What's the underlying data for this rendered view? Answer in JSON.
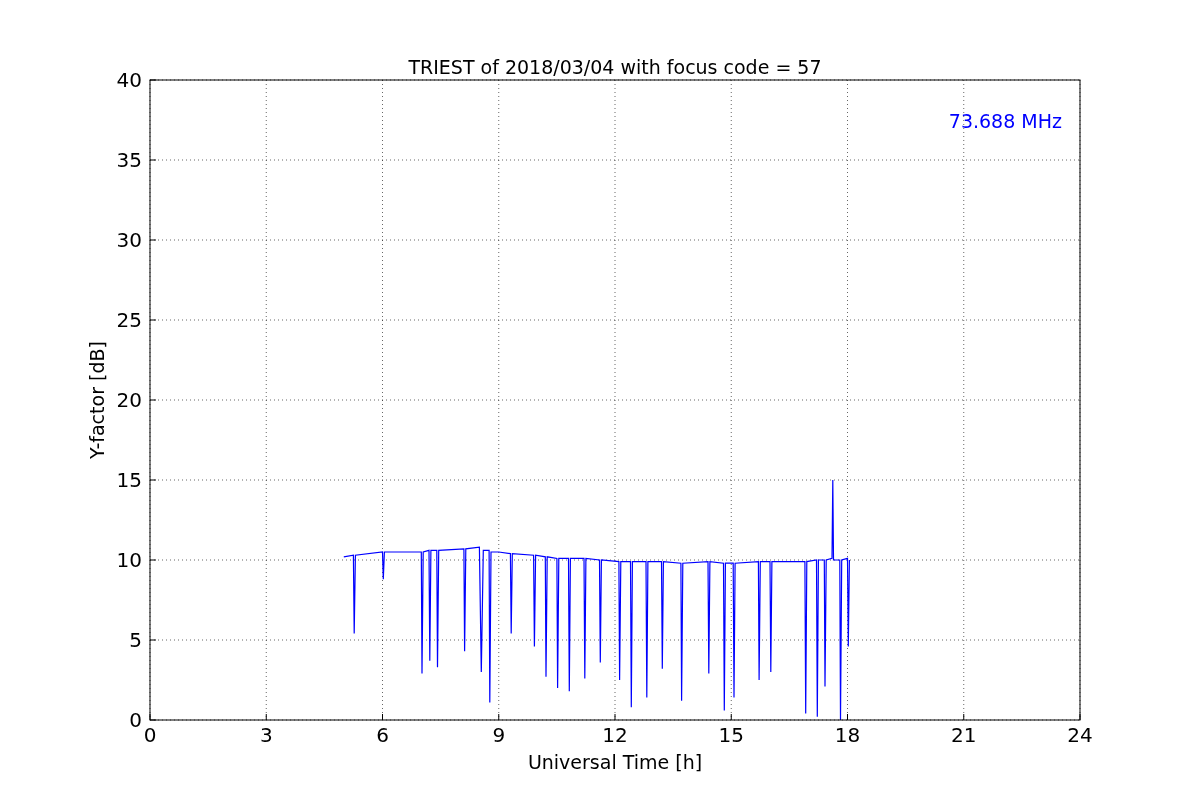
{
  "chart_data": {
    "type": "line",
    "title": "TRIEST of 2018/03/04 with focus code = 57",
    "xlabel": "Universal Time [h]",
    "ylabel": "Y-factor [dB]",
    "x": [
      5.0,
      5.25,
      5.27,
      5.3,
      6.0,
      6.02,
      6.05,
      7.0,
      7.02,
      7.05,
      7.2,
      7.22,
      7.25,
      7.4,
      7.42,
      7.45,
      8.1,
      8.12,
      8.15,
      8.5,
      8.55,
      8.6,
      8.75,
      8.77,
      8.8,
      9.0,
      9.3,
      9.32,
      9.35,
      9.9,
      9.92,
      9.95,
      10.2,
      10.22,
      10.25,
      10.5,
      10.52,
      10.55,
      10.8,
      10.82,
      10.85,
      11.2,
      11.22,
      11.25,
      11.6,
      11.62,
      11.65,
      12.1,
      12.12,
      12.15,
      12.4,
      12.42,
      12.45,
      12.8,
      12.82,
      12.85,
      13.2,
      13.22,
      13.25,
      13.7,
      13.72,
      13.75,
      14.4,
      14.42,
      14.45,
      14.8,
      14.82,
      14.85,
      15.05,
      15.07,
      15.1,
      15.7,
      15.72,
      15.75,
      16.0,
      16.02,
      16.05,
      16.9,
      16.92,
      16.95,
      17.2,
      17.22,
      17.25,
      17.4,
      17.42,
      17.45,
      17.6,
      17.62,
      17.64,
      17.8,
      17.82,
      17.85,
      18.0,
      18.02,
      18.05
    ],
    "series": [
      {
        "name": "73.688 MHz",
        "color": "#0000ff",
        "values": [
          10.2,
          10.3,
          5.4,
          10.3,
          10.5,
          8.8,
          10.5,
          10.5,
          2.9,
          10.5,
          10.6,
          3.7,
          10.6,
          10.6,
          3.3,
          10.6,
          10.7,
          4.3,
          10.7,
          10.8,
          3.0,
          10.6,
          10.6,
          1.1,
          10.5,
          10.5,
          10.4,
          5.4,
          10.4,
          10.3,
          4.6,
          10.3,
          10.2,
          2.7,
          10.2,
          10.1,
          2.0,
          10.1,
          10.1,
          1.8,
          10.1,
          10.1,
          2.6,
          10.1,
          10.0,
          3.6,
          10.0,
          9.9,
          2.5,
          9.9,
          9.9,
          0.8,
          9.9,
          9.9,
          1.4,
          9.9,
          9.9,
          3.2,
          9.9,
          9.8,
          1.2,
          9.8,
          9.9,
          2.9,
          9.9,
          9.8,
          0.6,
          9.8,
          9.8,
          1.4,
          9.8,
          9.9,
          2.5,
          9.9,
          9.9,
          3.0,
          9.9,
          9.9,
          0.4,
          9.9,
          10.0,
          0.2,
          10.0,
          10.0,
          2.1,
          10.0,
          10.1,
          15.0,
          10.0,
          10.0,
          0.0,
          10.0,
          10.1,
          4.6,
          10.0
        ]
      }
    ],
    "grid": true,
    "xlim": [
      0,
      24
    ],
    "ylim": [
      0,
      40
    ],
    "xticks": [
      0,
      3,
      6,
      9,
      12,
      15,
      18,
      21,
      24
    ],
    "yticks": [
      0,
      5,
      10,
      15,
      20,
      25,
      30,
      35,
      40
    ]
  }
}
